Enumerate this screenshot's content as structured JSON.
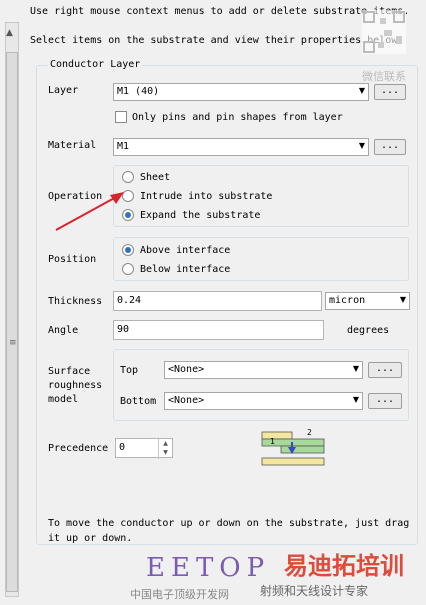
{
  "instructions": {
    "line1": "Use right mouse context menus to add or delete substrate items.",
    "line2": "Select items on the substrate and view their properties below"
  },
  "conductor_layer": {
    "title": "Conductor Layer",
    "layer_label": "Layer",
    "layer_value": "M1 (40)",
    "browse": "...",
    "only_pins_label": "Only pins and pin shapes from layer",
    "material_label": "Material",
    "material_value": "M1",
    "operation_label": "Operation",
    "operation_options": [
      "Sheet",
      "Intrude into substrate",
      "Expand the substrate"
    ],
    "operation_selected": "Expand the substrate",
    "position_label": "Position",
    "position_options": [
      "Above interface",
      "Below interface"
    ],
    "position_selected": "Above interface",
    "thickness_label": "Thickness",
    "thickness_value": "0.24",
    "thickness_unit": "micron",
    "angle_label": "Angle",
    "angle_value": "90",
    "angle_unit": "degrees",
    "surface_label_1": "Surface",
    "surface_label_2": "roughness",
    "surface_label_3": "model",
    "top_label": "Top",
    "top_value": "<None>",
    "bottom_label": "Bottom",
    "bottom_value": "<None>",
    "precedence_label": "Precedence",
    "precedence_value": "0",
    "diagram_label_1": "1",
    "diagram_label_2": "2"
  },
  "footer": {
    "line1": "To move the conductor up or down on the substrate, just drag",
    "line2": "it up or down."
  },
  "watermarks": {
    "qr_caption": "微信联系",
    "eetop": "EETOP",
    "eetop_sub": "中国电子顶级开发网",
    "brand": "易迪拓培训",
    "brand_sub": "射频和天线设计专家"
  },
  "colors": {
    "radio_selected": "#2c73c4",
    "arrow": "#d9232d",
    "eetop": "#7a5cb0",
    "brand": "#e04a3a"
  }
}
